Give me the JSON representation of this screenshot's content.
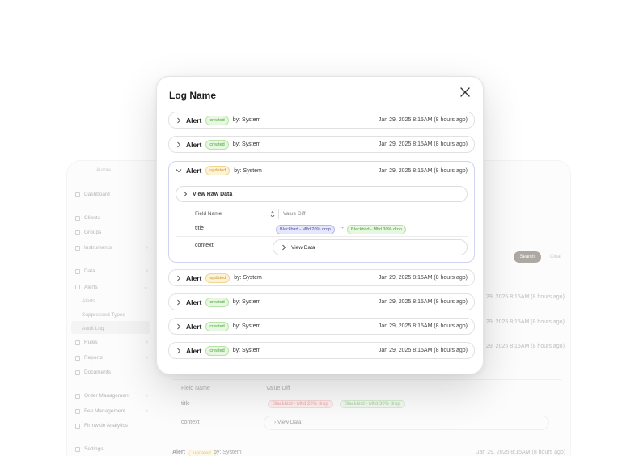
{
  "background": {
    "app_name": "Aurora",
    "sidebar": {
      "nav": [
        {
          "label": "Dashboard"
        },
        {
          "label": "Clients"
        },
        {
          "label": "Groups"
        },
        {
          "label": "Instruments"
        },
        {
          "label": "Data"
        },
        {
          "label": "Alerts"
        },
        {
          "label": "Rules"
        },
        {
          "label": "Reports"
        },
        {
          "label": "Documents"
        },
        {
          "label": "Order Management"
        },
        {
          "label": "Fee Management"
        },
        {
          "label": "Firmwide Analytics"
        },
        {
          "label": "Settings"
        }
      ],
      "alerts_sub": [
        "Alerts",
        "Suppressed Types",
        "Audit Log"
      ]
    },
    "search_label": "Search",
    "clear_label": "Clear",
    "timestamps": [
      "29, 2025 8:15AM (8 hours ago)",
      "29, 2025 8:15AM (8 hours ago)",
      "29, 2025 8:15AM (8 hours ago)",
      "Jan 29, 2025 8:15AM (8 hours ago)"
    ],
    "field_name_header": "Field Name",
    "value_diff_header": "Value Diff",
    "title_label": "title",
    "context_label": "context",
    "old_value": "Blackbird - Mlfd 20% drop",
    "new_value": "Blackbird - Mlfd 30% drop",
    "view_data_label": "View Data",
    "last_row": {
      "title": "Alert",
      "badge": "updated",
      "by": "by: System"
    }
  },
  "modal": {
    "title": "Log Name",
    "rows": [
      {
        "title": "Alert",
        "badge": "created",
        "by": "by: System",
        "timestamp": "Jan 29, 2025 8:15AM (8 hours ago)"
      },
      {
        "title": "Alert",
        "badge": "created",
        "by": "by: System",
        "timestamp": "Jan 29, 2025 8:15AM (8 hours ago)"
      },
      {
        "title": "Alert",
        "badge": "updated",
        "by": "by: System",
        "timestamp": "Jan 29, 2025 8:15AM (8 hours ago)"
      },
      {
        "title": "Alert",
        "badge": "updated",
        "by": "by: System",
        "timestamp": "Jan 29, 2025 8:15AM (8 hours ago)"
      },
      {
        "title": "Alert",
        "badge": "created",
        "by": "by: System",
        "timestamp": "Jan 29, 2025 8:15AM (8 hours ago)"
      },
      {
        "title": "Alert",
        "badge": "created",
        "by": "by: System",
        "timestamp": "Jan 29, 2025 8:15AM (8 hours ago)"
      },
      {
        "title": "Alert",
        "badge": "created",
        "by": "by: System",
        "timestamp": "Jan 29, 2025 8:15AM (8 hours ago)"
      }
    ],
    "expanded": {
      "view_raw_label": "View Raw Data",
      "field_name_header": "Field Name",
      "value_diff_header": "Value Diff",
      "fields": [
        {
          "name": "title",
          "old": "Blackbird - Mlfd 20% drop",
          "arrow": "→",
          "new": "Blackbird - Mlfd 30% drop"
        },
        {
          "name": "context",
          "button": "View Data"
        }
      ]
    }
  },
  "colors": {
    "created": "#4ba13a",
    "updated": "#c89b2d",
    "accent_border": "#cfd3ef",
    "search_button": "#6d6259"
  }
}
